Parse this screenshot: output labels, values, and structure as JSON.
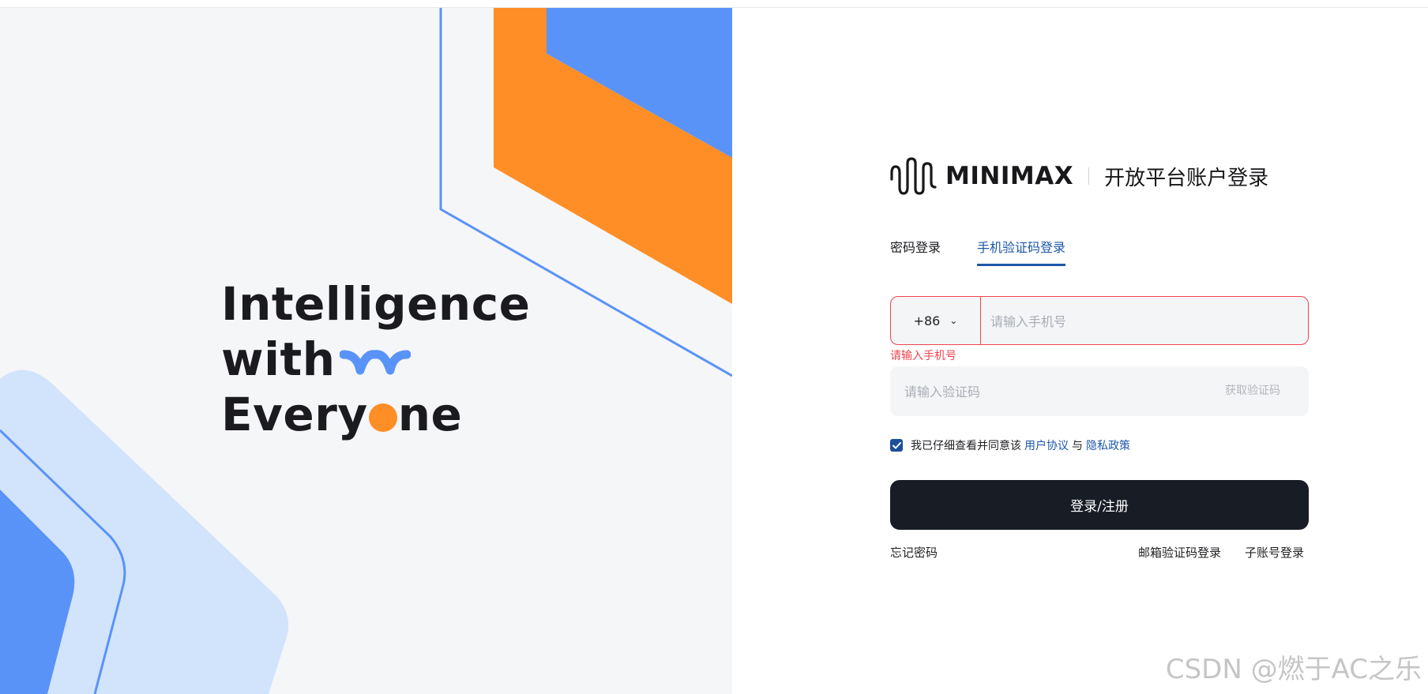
{
  "hero": {
    "tagline_line1": "Intelligence",
    "tagline_line2": "with",
    "tagline_line3_a": "Every",
    "tagline_line3_b": "ne"
  },
  "brand": {
    "name": "MINIMAX",
    "subtitle": "开放平台账户登录"
  },
  "tabs": [
    {
      "label": "密码登录",
      "active": false
    },
    {
      "label": "手机验证码登录",
      "active": true
    }
  ],
  "phone": {
    "country_code": "+86",
    "placeholder": "请输入手机号",
    "error": "请输入手机号"
  },
  "code": {
    "placeholder": "请输入验证码",
    "get_code_label": "获取验证码"
  },
  "agreement": {
    "checked": true,
    "text": "我已仔细查看并同意该",
    "terms_label": "用户协议",
    "and": "与",
    "privacy_label": "隐私政策"
  },
  "submit_label": "登录/注册",
  "footer_links": {
    "forgot": "忘记密码",
    "email_login": "邮箱验证码登录",
    "sub_account": "子账号登录"
  },
  "watermark": "CSDN @燃于AC之乐",
  "colors": {
    "accent_blue": "#1d58a8",
    "orange": "#ff8e26",
    "light_blue": "#5a93f7",
    "error_red": "#f0444f",
    "button_dark": "#181c24"
  }
}
